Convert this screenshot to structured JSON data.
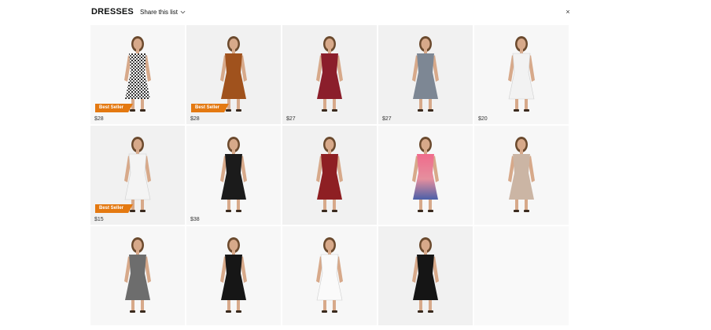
{
  "header": {
    "title": "DRESSES",
    "share_label": "Share this list",
    "close_glyph": "×"
  },
  "badge_color": "#e47911",
  "items": [
    {
      "price": "$28",
      "badge": "Best Seller",
      "dress_color": "#3b3b3b",
      "pattern": "gingham"
    },
    {
      "price": "$28",
      "badge": "Best Seller",
      "dress_color": "#a0521d"
    },
    {
      "price": "$27",
      "badge": "",
      "dress_color": "#8b1e2b"
    },
    {
      "price": "$27",
      "badge": "",
      "dress_color": "#7d8794"
    },
    {
      "price": "$20",
      "badge": "",
      "dress_color": "#f2f2f2"
    },
    {
      "price": "$15",
      "badge": "Best Seller",
      "dress_color": "#f4f4f4"
    },
    {
      "price": "$38",
      "badge": "",
      "dress_color": "#1b1b1b"
    },
    {
      "price": "",
      "badge": "",
      "dress_color": "#8e1f23"
    },
    {
      "price": "",
      "badge": "",
      "dress_color": "#d8668a",
      "pattern": "gradient"
    },
    {
      "price": "",
      "badge": "",
      "dress_color": "#cbb5a4"
    },
    {
      "price": "",
      "badge": "",
      "dress_color": "#6d6d6d"
    },
    {
      "price": "",
      "badge": "",
      "dress_color": "#161616"
    },
    {
      "price": "",
      "badge": "",
      "dress_color": "#fafafa"
    },
    {
      "price": "",
      "badge": "",
      "dress_color": "#151515"
    },
    {
      "price": "",
      "badge": "",
      "dress_color": "",
      "empty": true
    }
  ]
}
